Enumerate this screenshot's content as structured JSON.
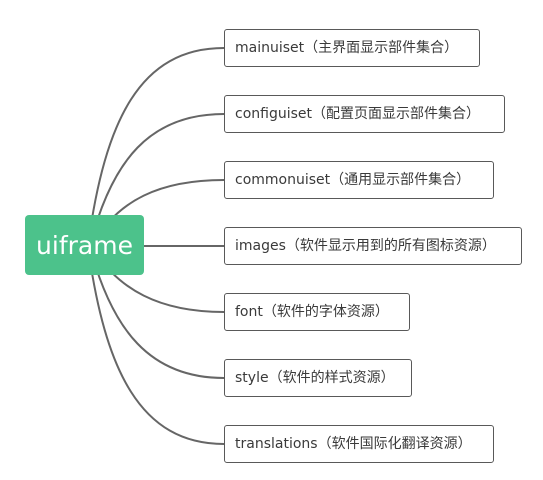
{
  "root": {
    "label": "uiframe"
  },
  "children": [
    {
      "label": "mainuiset（主界面显示部件集合）"
    },
    {
      "label": "configuiset（配置页面显示部件集合）"
    },
    {
      "label": "commonuiset（通用显示部件集合）"
    },
    {
      "label": "images（软件显示用到的所有图标资源）"
    },
    {
      "label": "font（软件的字体资源）"
    },
    {
      "label": "style（软件的样式资源）"
    },
    {
      "label": "translations（软件国际化翻译资源）"
    }
  ],
  "colors": {
    "root_fill": "#4cc28b",
    "root_text": "#ffffff",
    "connector": "#666666",
    "node_border": "#595959",
    "node_text": "#3a3a3a"
  }
}
